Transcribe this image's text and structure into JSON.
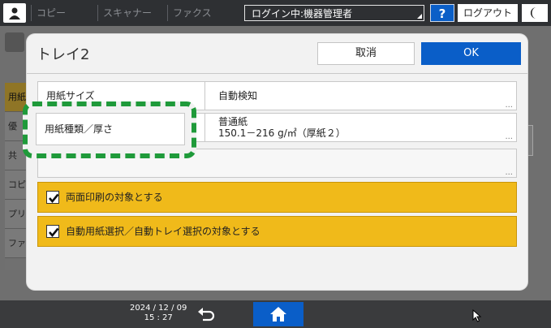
{
  "topbar": {
    "apps": [
      "コピー",
      "スキャナー",
      "ファクス"
    ],
    "login_status": "ログイン中:機器管理者",
    "help_label": "?",
    "logout_label": "ログアウト"
  },
  "background": {
    "tabs": [
      "用紙",
      "優",
      "共",
      "コピ",
      "プリ",
      "ファ"
    ]
  },
  "dialog": {
    "title": "トレイ2",
    "cancel_label": "取消",
    "ok_label": "OK",
    "rows": [
      {
        "label": "用紙サイズ",
        "value": "自動検知",
        "more": "..."
      },
      {
        "label": "用紙種類／厚さ",
        "value_line1": "普通紙",
        "value_line2": "150.1－216 g/㎡（厚紙２）",
        "more": "..."
      },
      {
        "more": "..."
      }
    ],
    "checks": [
      {
        "label": "両面印刷の対象とする",
        "checked": true
      },
      {
        "label": "自動用紙選択／自動トレイ選択の対象とする",
        "checked": true
      }
    ],
    "highlight_label": "用紙種類／厚さ"
  },
  "statusbar": {
    "date": "2024 / 12 / 09",
    "time": "15 : 27"
  },
  "colors": {
    "accent_blue": "#0a5ec8",
    "check_yellow": "#f0ba1a",
    "highlight_green": "#1f9a3a"
  }
}
